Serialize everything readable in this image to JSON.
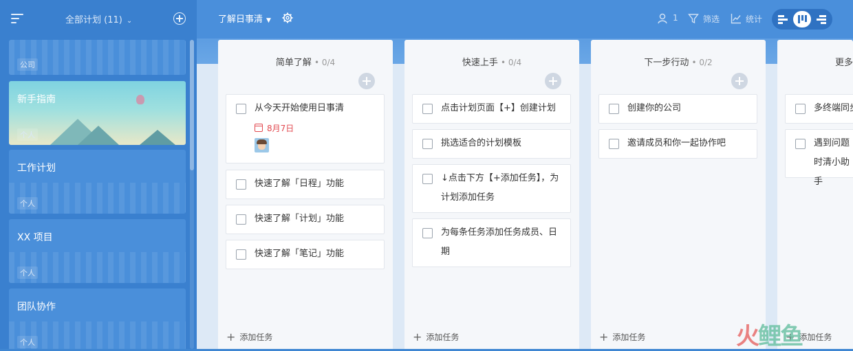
{
  "sidebar": {
    "plan_switch": "全部计划 (11)",
    "plans": [
      {
        "title": "",
        "tag": "公司"
      },
      {
        "title": "新手指南",
        "tag": "个人"
      },
      {
        "title": "工作计划",
        "tag": "个人"
      },
      {
        "title": "XX 项目",
        "tag": "个人"
      },
      {
        "title": "团队协作",
        "tag": "个人"
      }
    ]
  },
  "header": {
    "project_title": "了解日事清",
    "members_count": "1",
    "filter_label": "筛选",
    "stats_label": "统计"
  },
  "columns": [
    {
      "title": "简单了解",
      "count": "• 0/4",
      "tasks": [
        {
          "text": "从今天开始使用日事清",
          "due": "8月7日"
        },
        {
          "text": "快速了解「日程」功能"
        },
        {
          "text": "快速了解「计划」功能"
        },
        {
          "text": "快速了解「笔记」功能"
        }
      ],
      "add_label": "添加任务"
    },
    {
      "title": "快速上手",
      "count": "• 0/4",
      "tasks": [
        {
          "text": "点击计划页面【+】创建计划"
        },
        {
          "text": "挑选适合的计划模板"
        },
        {
          "text": "↓点击下方【+添加任务】，为计划添加任务"
        },
        {
          "text": "为每条任务添加任务成员、日期"
        }
      ],
      "add_label": "添加任务"
    },
    {
      "title": "下一步行动",
      "count": "• 0/2",
      "tasks": [
        {
          "text": "创建你的公司"
        },
        {
          "text": "邀请成员和你一起协作吧"
        }
      ],
      "add_label": "添加任务"
    },
    {
      "title": "更多",
      "count": "",
      "tasks": [
        {
          "text": "多终端同步"
        },
        {
          "text": "遇到问题时清小助手"
        }
      ],
      "add_label": "添加任务"
    }
  ],
  "watermark": {
    "part1": "火",
    "part2": "鲤鱼"
  },
  "icons": {
    "menu": "hamburger-icon",
    "add": "plus-circle-icon",
    "settings": "gear-icon",
    "members": "user-icon",
    "filter": "funnel-icon",
    "stats": "chart-line-icon",
    "calendar": "calendar-icon"
  },
  "colors": {
    "sidebar_bg": "#3a80cf",
    "main_bg": "#4a8fdb",
    "due_date": "#e2484f",
    "toggle_bg": "#2f72c2"
  }
}
